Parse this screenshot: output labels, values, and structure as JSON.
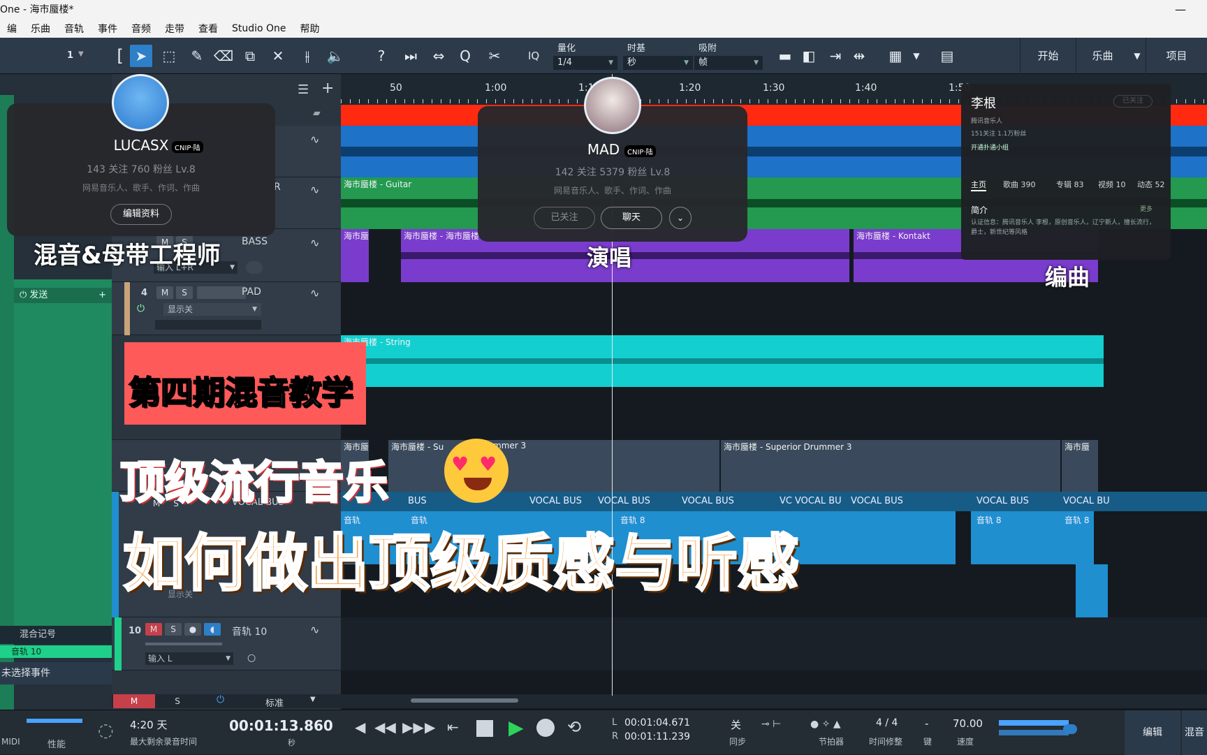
{
  "window": {
    "title": "One - 海市蜃楼*"
  },
  "menu": [
    "编",
    "乐曲",
    "音轨",
    "事件",
    "音频",
    "走带",
    "查看",
    "Studio One",
    "帮助"
  ],
  "toolbar": {
    "left_value": "1",
    "quantize_label": "量化",
    "quantize_value": "1/4",
    "timebase_label": "时基",
    "timebase_value": "秒",
    "snap_label": "吸附",
    "snap_value": "帧",
    "iq_label": "IQ",
    "right_buttons": [
      "开始",
      "乐曲",
      "项目"
    ]
  },
  "ruler": {
    "ticks": [
      "50",
      "1:00",
      "1:1",
      "1:20",
      "1:30",
      "1:40",
      "1:50"
    ]
  },
  "tracks": [
    {
      "num": "",
      "name": "",
      "input": ""
    },
    {
      "num": "",
      "name": "R",
      "input": ""
    },
    {
      "num": "",
      "name": "BASS",
      "input": "输入 L+R"
    },
    {
      "num": "4",
      "name": "PAD",
      "input": "显示关"
    },
    {
      "num": "10",
      "name": "音轨 10",
      "input": "输入 L"
    }
  ],
  "track_buttons": {
    "m": "M",
    "s": "S"
  },
  "vocal_bus_hdr": "VOCAL BUS",
  "hidden_label": "显示关",
  "inspector": {
    "send": "发送",
    "mix_label": "混合记号",
    "track_label": "音轨 10",
    "no_event": "未选择事件"
  },
  "clips": {
    "guitar": "海市蜃楼 - Guitar",
    "bass1": "海市蜃",
    "bass2": "海市蜃楼 - 海市蜃楼 -",
    "kontakt": "海市蜃楼 - Kontakt",
    "string": "海市蜃楼 - String",
    "drum1": "海市蜃",
    "drum2": "海市蜃楼 - Su",
    "drum2b": "mmer 3",
    "drum3": "海市蜃楼 - Superior Drummer 3",
    "drum4": "海市蜃",
    "vocal_bus": [
      "BUS",
      "VOCAL BUS",
      "VOCAL BUS",
      "VOCAL BUS",
      "VC",
      "VOCAL BU",
      "VOCAL BUS",
      "VOCAL BUS",
      "VOCAL BU"
    ],
    "track8": [
      "音轨",
      "音轨",
      "音轨 8",
      "音轨 8",
      "音轨 8"
    ]
  },
  "bottom_tabs": {
    "m": "M",
    "s": "S",
    "mode": "标准"
  },
  "profile1": {
    "name": "LUCASX",
    "stats": "143 关注    760 粉丝    Lv.8",
    "desc": "网易音乐人、歌手、作词、作曲",
    "button": "编辑资料",
    "badge": "CNIP·陆"
  },
  "profile2": {
    "name": "MAD",
    "stats": "142 关注    5379 粉丝    Lv.8",
    "desc": "网易音乐人、歌手、作词、作曲",
    "btn_follow": "已关注",
    "btn_chat": "聊天",
    "badge": "CNIP·陆"
  },
  "profile3": {
    "name": "李根",
    "follow_tag": "已关注",
    "verify": "腾讯音乐人",
    "stats": "151关注    1.1万粉丝",
    "vip": "开通扑通小组",
    "tabs": [
      "主页",
      "歌曲 390",
      "专辑 83",
      "视频 10",
      "动态 52"
    ],
    "intro": "简介",
    "more": "更多",
    "intro_text": "认证信息：腾讯音乐人 李根，原创音乐人，辽宁新人，擅长流行，爵士，新世纪等风格"
  },
  "overlays": {
    "engineer": "混音&母带工程师",
    "sing": "演唱",
    "arrange": "编曲",
    "episode": "第四期混音教学",
    "top_pop": "顶级流行音乐",
    "headline": "如何做出顶级质感与听感"
  },
  "transport": {
    "midi": "MIDI",
    "perf": "性能",
    "remain_val": "4:20 天",
    "remain_label": "最大剩余录音时间",
    "time_val": "00:01:13.860",
    "time_unit": "秒",
    "l_val": "00:01:04.671",
    "r_val": "00:01:11.239",
    "sync_val": "关",
    "sync_label": "同步",
    "metro_label": "节拍器",
    "sig_val": "4 / 4",
    "sig_label": "时间修整",
    "key_val": "-",
    "key_label": "键",
    "tempo_val": "70.00",
    "tempo_label": "速度",
    "edit": "编辑",
    "mix": "混音",
    "L": "L",
    "R": "R"
  },
  "colors": {
    "red_lane": "#ff2a10",
    "blue_lane": "#1e72c8",
    "green_lane": "#239a50",
    "purple_lane": "#7a3ccc",
    "cyan_lane": "#14cfd0",
    "drum_lane": "#3a4a5c",
    "vocal_lane": "#1f8fd0",
    "accent": "#f39b3a"
  }
}
